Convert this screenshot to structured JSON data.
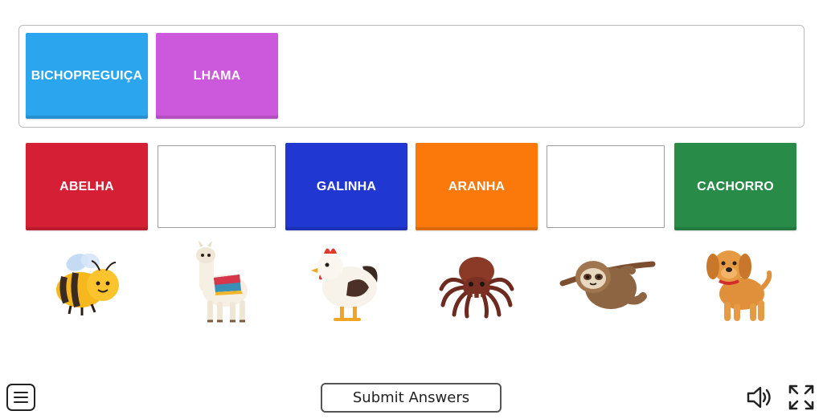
{
  "bank": {
    "tiles": [
      {
        "label": "BICHOPREGUIÇA",
        "color": "#2ba6ee"
      },
      {
        "label": "LHAMA",
        "color": "#cc58db"
      }
    ]
  },
  "slots": [
    {
      "label": "ABELHA",
      "color": "#d41f35"
    },
    {
      "label": "",
      "empty": true
    },
    {
      "label": "GALINHA",
      "color": "#2137d2"
    },
    {
      "label": "ARANHA",
      "color": "#fb780b"
    },
    {
      "label": "",
      "empty": true
    },
    {
      "label": "CACHORRO",
      "color": "#288b48"
    }
  ],
  "pictures": [
    "bee-image",
    "llama-image",
    "chicken-image",
    "spider-image",
    "sloth-image",
    "dog-image"
  ],
  "footer": {
    "submit_label": "Submit Answers",
    "menu_icon": "hamburger-menu-icon",
    "sound_icon": "speaker-icon",
    "fullscreen_icon": "fullscreen-icon"
  }
}
